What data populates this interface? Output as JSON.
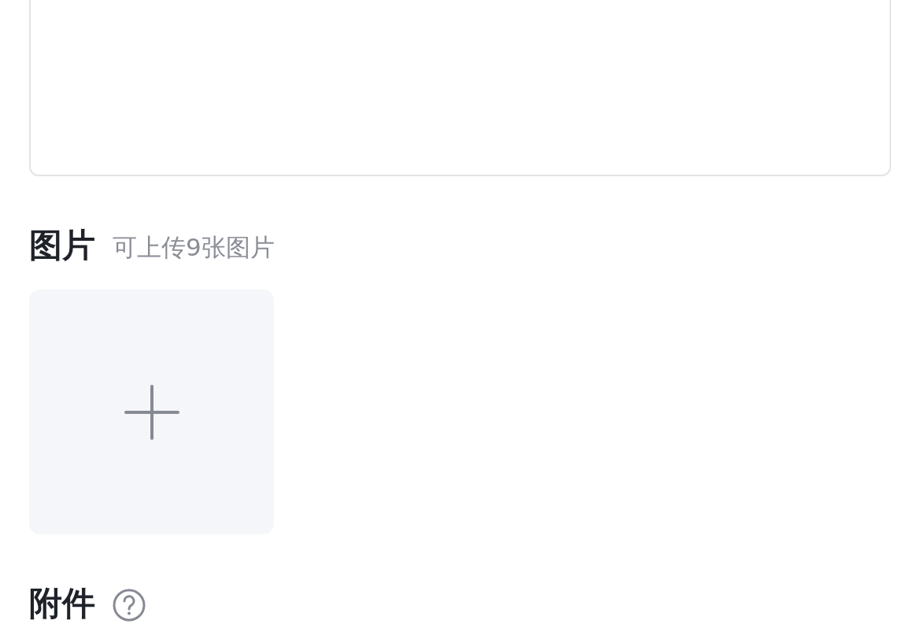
{
  "images": {
    "label": "图片",
    "hint": "可上传9张图片"
  },
  "attachments": {
    "label": "附件"
  }
}
